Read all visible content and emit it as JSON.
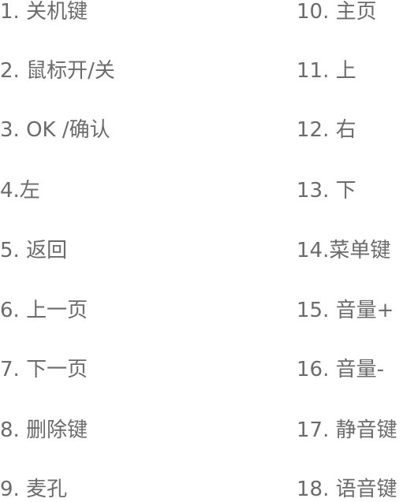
{
  "legend": {
    "left": [
      "1. 关机键",
      "2. 鼠标开/关",
      "3. OK /确认",
      "4.左",
      "5.  返回",
      "6. 上一页",
      "7. 下一页",
      "8. 删除键",
      "9. 麦孔"
    ],
    "right": [
      "10. 主页",
      "11. 上",
      "12. 右",
      "13. 下",
      "14.菜单键",
      "15. 音量+",
      "16. 音量-",
      "17. 静音键",
      "18. 语音键"
    ]
  }
}
